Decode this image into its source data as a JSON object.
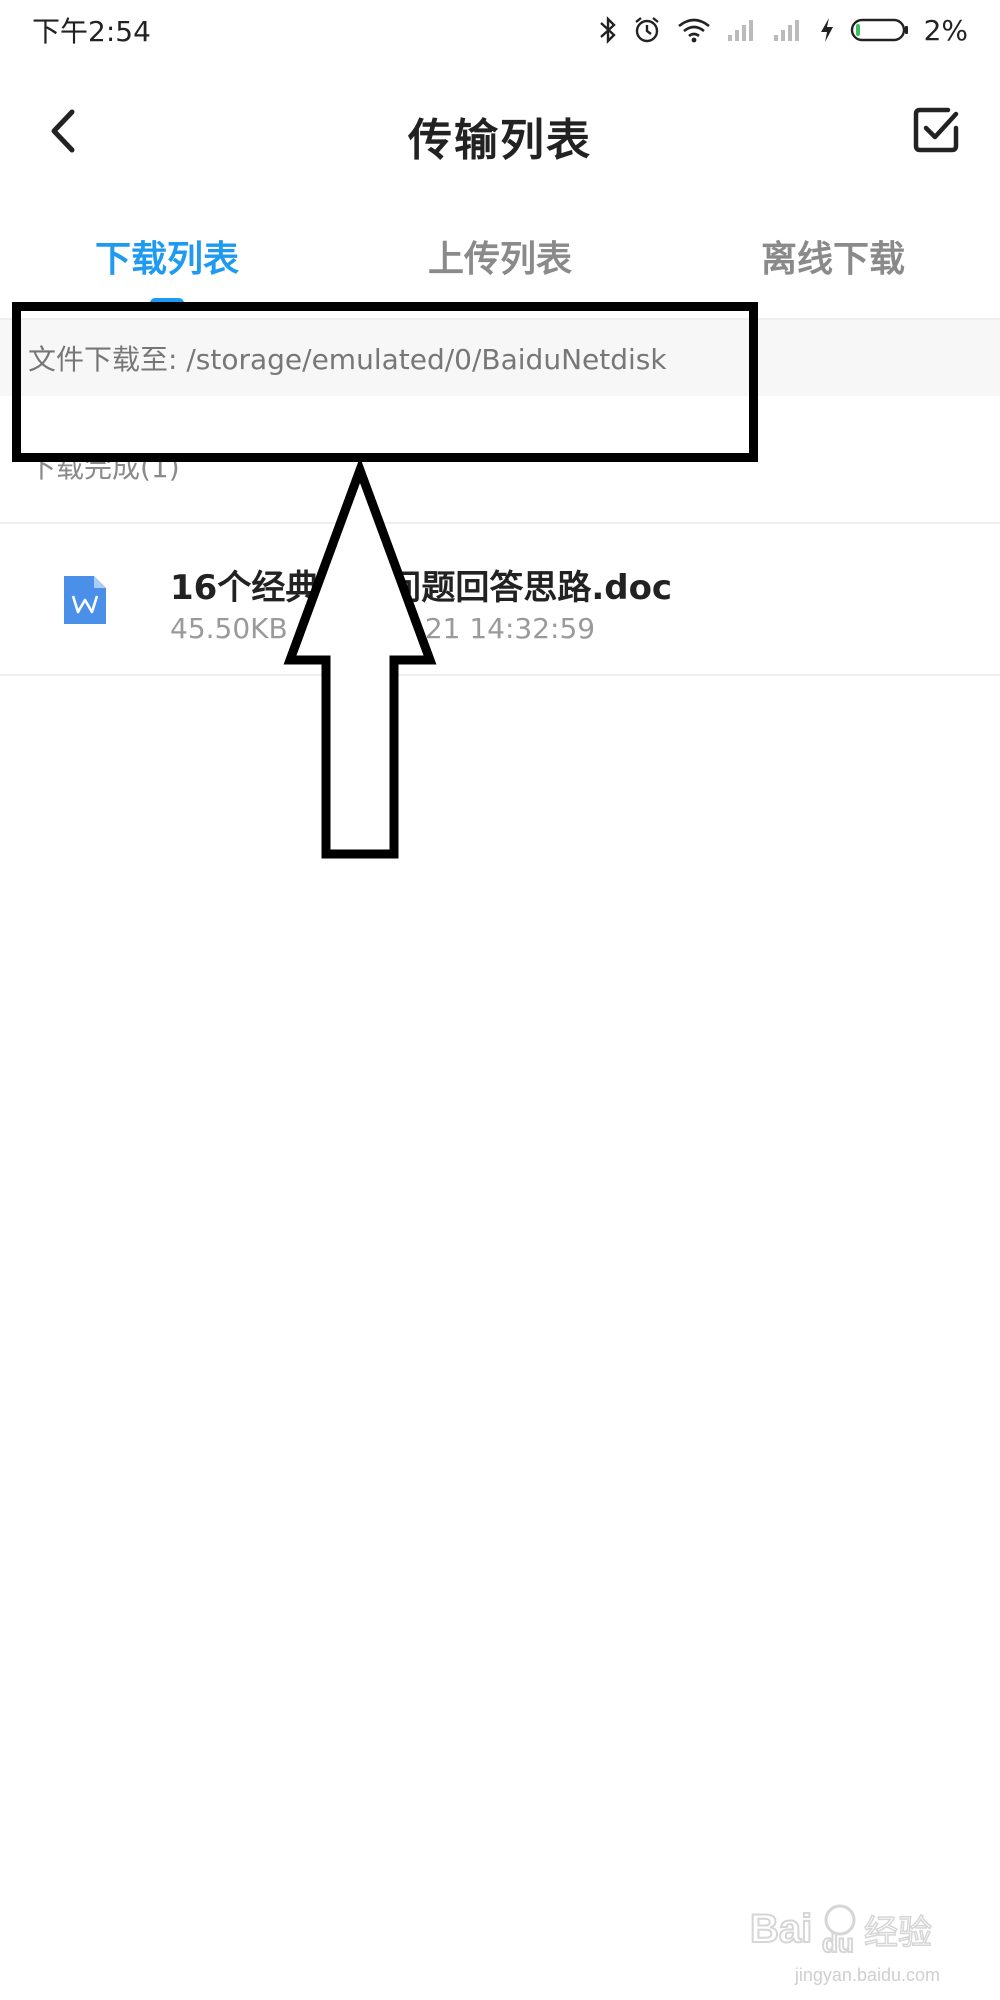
{
  "status_bar": {
    "time": "下午2:54",
    "battery": "2%",
    "icons": [
      "bluetooth-icon",
      "alarm-icon",
      "wifi-icon",
      "signal-icon",
      "signal-icon",
      "charging-icon",
      "battery-icon"
    ]
  },
  "header": {
    "title": "传输列表",
    "back_icon": "chevron-left-icon",
    "select_icon": "checkbox-icon"
  },
  "tabs": [
    {
      "label": "下载列表",
      "active": true
    },
    {
      "label": "上传列表",
      "active": false
    },
    {
      "label": "离线下载",
      "active": false
    }
  ],
  "path": {
    "text": "文件下载至: /storage/emulated/0/BaiduNetdisk"
  },
  "section": {
    "title": "下载完成(1)"
  },
  "files": [
    {
      "name": "16个经典面试问题回答思路.doc",
      "size": "45.50KB",
      "date": "2019-08-21 14:32:59",
      "icon": "word-doc-icon"
    }
  ],
  "colors": {
    "accent": "#1e9bf0",
    "tab_inactive": "#8a8a8a",
    "doc_icon": "#4a90e8"
  },
  "watermark": {
    "logo": "Bai du 经验",
    "url": "jingyan.baidu.com"
  }
}
